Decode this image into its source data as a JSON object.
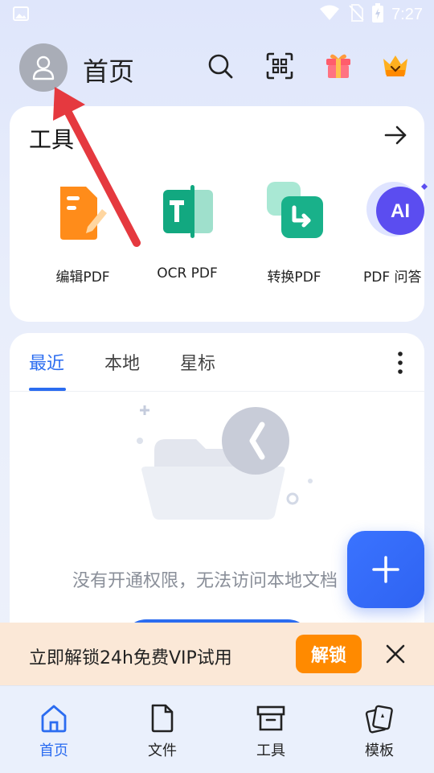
{
  "status_bar": {
    "time": "7:27"
  },
  "header": {
    "title": "首页"
  },
  "tools": {
    "title": "工具",
    "items": [
      {
        "label": "编辑PDF",
        "icon": "edit-pdf-icon"
      },
      {
        "label": "OCR PDF",
        "icon": "ocr-pdf-icon"
      },
      {
        "label": "转换PDF",
        "icon": "convert-pdf-icon"
      },
      {
        "label": "PDF 问答",
        "icon": "ai-pdf-icon"
      }
    ]
  },
  "recent": {
    "tabs": [
      {
        "label": "最近",
        "active": true
      },
      {
        "label": "本地",
        "active": false
      },
      {
        "label": "星标",
        "active": false
      }
    ],
    "empty_text": "没有开通权限，无法访问本地文档"
  },
  "vip_banner": {
    "text": "立即解锁24h免费VIP试用",
    "button": "解锁"
  },
  "bottom_nav": [
    {
      "label": "首页",
      "icon": "home-icon",
      "active": true
    },
    {
      "label": "文件",
      "icon": "file-icon",
      "active": false
    },
    {
      "label": "工具",
      "icon": "toolbox-icon",
      "active": false
    },
    {
      "label": "模板",
      "icon": "template-icon",
      "active": false
    }
  ],
  "colors": {
    "accent": "#2b6cf0",
    "vip_orange": "#ff8a00",
    "arrow_red": "#e5393f"
  }
}
